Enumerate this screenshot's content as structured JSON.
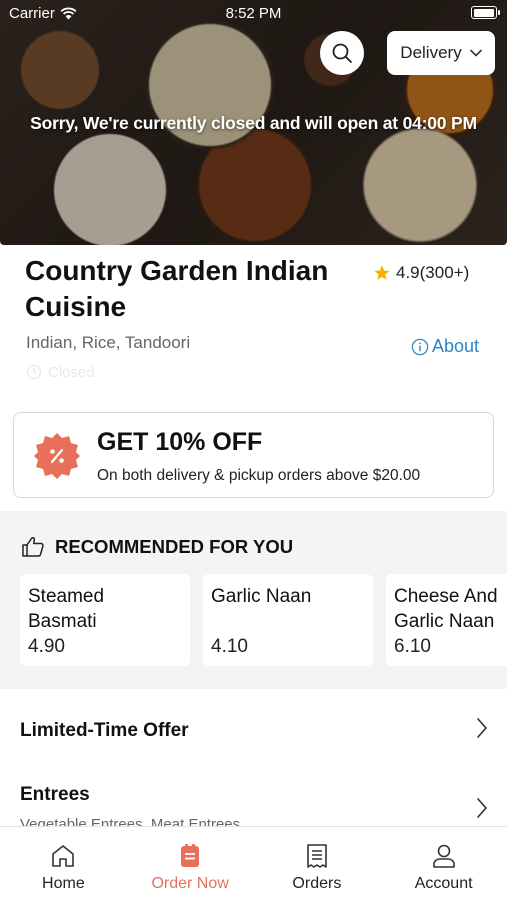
{
  "status_bar": {
    "carrier": "Carrier",
    "time": "8:52 PM",
    "battery_level": 1.0
  },
  "hero": {
    "closed_message": "Sorry, We're currently closed and will open at 04:00 PM",
    "mode_selector": "Delivery"
  },
  "restaurant": {
    "name": "Country Garden Indian Cuisine",
    "rating": "4.9(300+)",
    "cuisines": "Indian, Rice, Tandoori",
    "about_label": "About",
    "status": "Closed"
  },
  "promo": {
    "title": "GET 10% OFF",
    "subtitle": "On both delivery & pickup orders above $20.00"
  },
  "recommended": {
    "heading": "RECOMMENDED FOR YOU",
    "items": [
      {
        "name_line1": "Steamed",
        "name_line2": "Basmati",
        "price": "4.90"
      },
      {
        "name_line1": "Garlic Naan",
        "name_line2": "",
        "price": "4.10"
      },
      {
        "name_line1": "Cheese And",
        "name_line2": "Garlic Naan",
        "price": "6.10"
      }
    ]
  },
  "menu": [
    {
      "title": "Limited-Time Offer",
      "subtitle": ""
    },
    {
      "title": "Entrees",
      "subtitle": "Vegetable Entrees, Meat Entrees"
    }
  ],
  "tabs": [
    {
      "label": "Home",
      "icon": "home-icon"
    },
    {
      "label": "Order Now",
      "icon": "order-icon"
    },
    {
      "label": "Orders",
      "icon": "receipt-icon"
    },
    {
      "label": "Account",
      "icon": "person-icon"
    }
  ],
  "colors": {
    "accent": "#e8705a",
    "link": "#2a86c8",
    "star": "#f5b400"
  }
}
